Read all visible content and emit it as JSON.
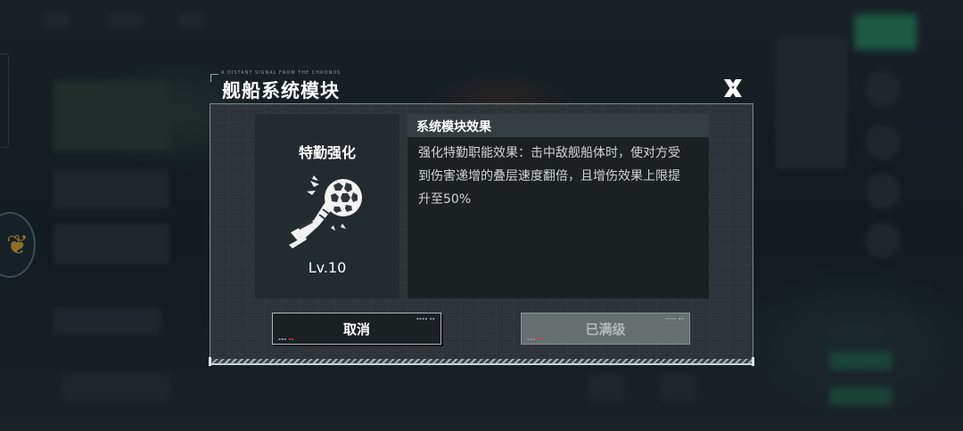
{
  "dialog": {
    "title": "舰船系统模块",
    "title_caption": "A DISTANT SIGNAL FROM THE CHRONOS",
    "close_icon": "close-x-icon"
  },
  "module": {
    "name": "特勤强化",
    "level": "Lv.10",
    "icon": "projectile-burst-icon"
  },
  "effect": {
    "header": "系统模块效果",
    "description": "强化特勤职能效果：击中敌舰船体时，使对方受到伤害递增的叠层速度翻倍，且增伤效果上限提升至50%"
  },
  "buttons": {
    "cancel_label": "取消",
    "max_level_label": "已满级"
  },
  "colors": {
    "panel_border": "#7e888b",
    "button_cancel_bg": "#1b2023",
    "button_disabled_bg": "#666e70",
    "text_primary": "#ffffff"
  }
}
